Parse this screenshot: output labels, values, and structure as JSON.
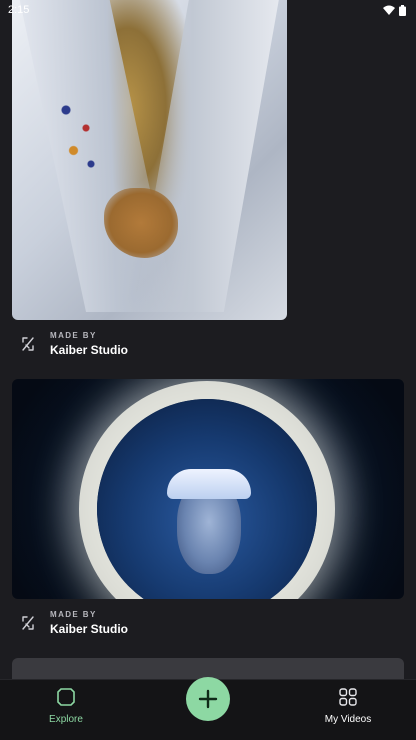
{
  "status_bar": {
    "time": "2:15",
    "icons": [
      "wifi-icon",
      "battery-icon"
    ]
  },
  "feed": {
    "items": [
      {
        "made_by_label": "MADE BY",
        "creator": "Kaiber Studio",
        "icon": "kaiber-logo-icon"
      },
      {
        "made_by_label": "MADE BY",
        "creator": "Kaiber Studio",
        "icon": "kaiber-logo-icon"
      }
    ]
  },
  "bottom_nav": {
    "items": [
      {
        "label": "Explore",
        "icon": "explore-icon",
        "active": true
      },
      {
        "label": "My Videos",
        "icon": "grid-icon",
        "active": false
      }
    ],
    "fab_icon": "plus-icon"
  },
  "colors": {
    "background": "#1c1c20",
    "nav_background": "#141416",
    "accent": "#8dd8a3",
    "muted_text": "#b7b7bd"
  }
}
